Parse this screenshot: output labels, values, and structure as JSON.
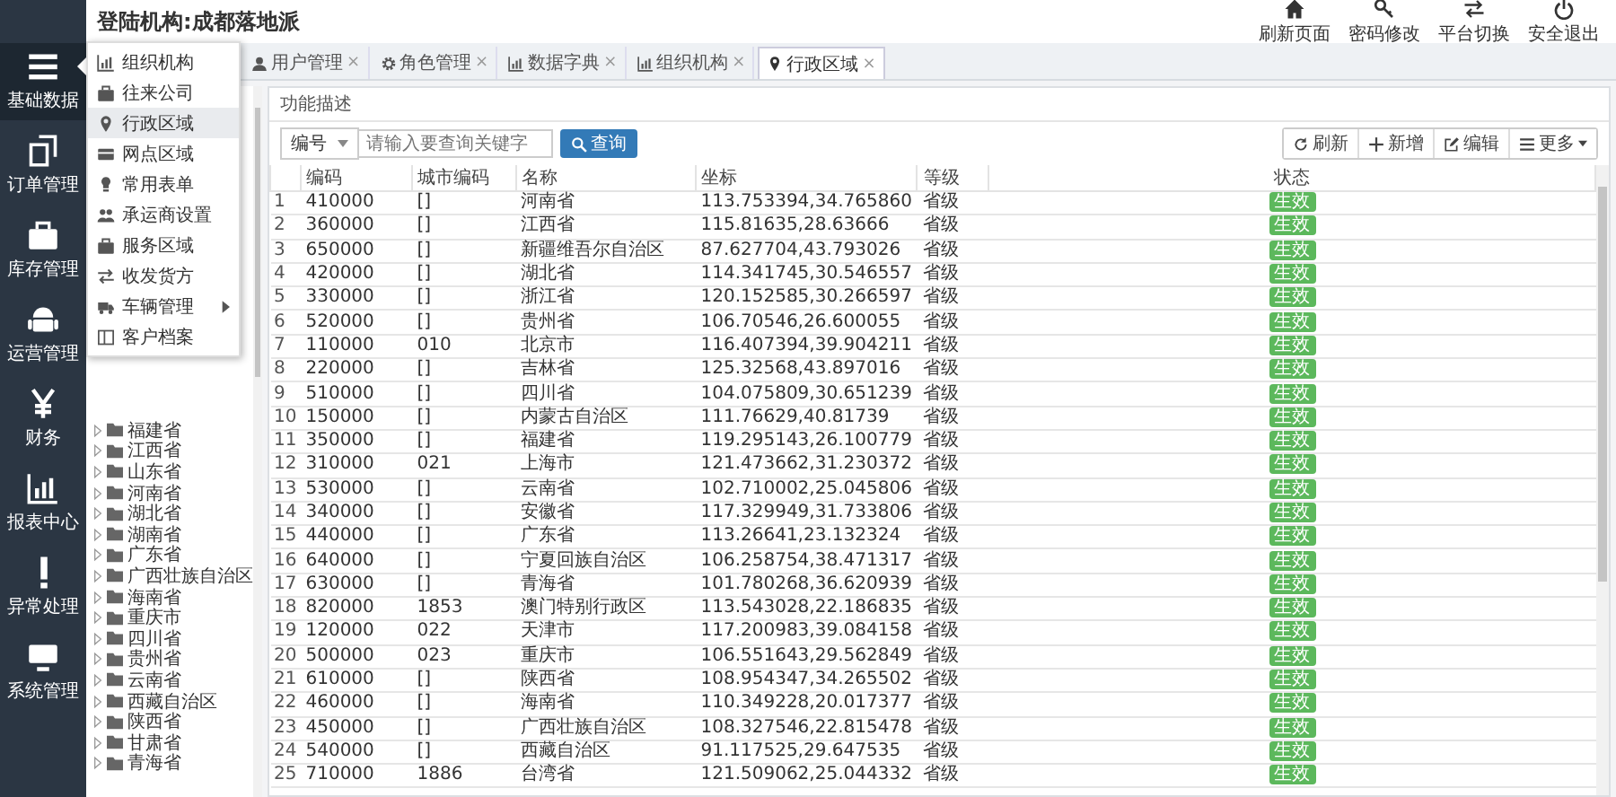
{
  "header": {
    "title": "登陆机构:成都落地派",
    "actions": [
      {
        "label": "刷新页面"
      },
      {
        "label": "密码修改"
      },
      {
        "label": "平台切换"
      },
      {
        "label": "安全退出"
      }
    ]
  },
  "nav": [
    {
      "label": "基础数据",
      "selected": true
    },
    {
      "label": "订单管理",
      "selected": false
    },
    {
      "label": "库存管理",
      "selected": false
    },
    {
      "label": "运营管理",
      "selected": false
    },
    {
      "label": "财务",
      "selected": false
    },
    {
      "label": "报表中心",
      "selected": false
    },
    {
      "label": "异常处理",
      "selected": false
    },
    {
      "label": "系统管理",
      "selected": false
    }
  ],
  "menu": [
    {
      "label": "组织机构",
      "selected": false,
      "submenu": false
    },
    {
      "label": "往来公司",
      "selected": false,
      "submenu": false
    },
    {
      "label": "行政区域",
      "selected": true,
      "submenu": false
    },
    {
      "label": "网点区域",
      "selected": false,
      "submenu": false
    },
    {
      "label": "常用表单",
      "selected": false,
      "submenu": false
    },
    {
      "label": "承运商设置",
      "selected": false,
      "submenu": false
    },
    {
      "label": "服务区域",
      "selected": false,
      "submenu": false
    },
    {
      "label": "收发货方",
      "selected": false,
      "submenu": false
    },
    {
      "label": "车辆管理",
      "selected": false,
      "submenu": true
    },
    {
      "label": "客户档案",
      "selected": false,
      "submenu": false
    }
  ],
  "tabs": [
    {
      "label": "用户管理",
      "close": "×",
      "selected": false
    },
    {
      "label": "角色管理",
      "close": "×",
      "selected": false
    },
    {
      "label": "数据字典",
      "close": "×",
      "selected": false
    },
    {
      "label": "组织机构",
      "close": "×",
      "selected": false
    },
    {
      "label": "行政区域",
      "close": "×",
      "selected": true
    }
  ],
  "tree": {
    "items": [
      {
        "label": "福建省"
      },
      {
        "label": "江西省"
      },
      {
        "label": "山东省"
      },
      {
        "label": "河南省"
      },
      {
        "label": "湖北省"
      },
      {
        "label": "湖南省"
      },
      {
        "label": "广东省"
      },
      {
        "label": "广西壮族自治区"
      },
      {
        "label": "海南省"
      },
      {
        "label": "重庆市"
      },
      {
        "label": "四川省"
      },
      {
        "label": "贵州省"
      },
      {
        "label": "云南省"
      },
      {
        "label": "西藏自治区"
      },
      {
        "label": "陕西省"
      },
      {
        "label": "甘肃省"
      },
      {
        "label": "青海省"
      }
    ]
  },
  "panel": {
    "title": "功能描述",
    "search": {
      "field": "编号",
      "placeholder": "请输入要查询关键字",
      "button": "查询"
    },
    "toolbar": [
      {
        "label": "刷新",
        "caret": false
      },
      {
        "label": "新增",
        "caret": false
      },
      {
        "label": "编辑",
        "caret": false
      },
      {
        "label": "更多",
        "caret": true
      }
    ]
  },
  "table": {
    "columns": [
      "",
      "编码",
      "城市编码",
      "名称",
      "坐标",
      "等级",
      "状态"
    ],
    "rows": [
      [
        "1",
        "410000",
        "[]",
        "河南省",
        "113.753394,34.765860",
        "省级",
        "生效"
      ],
      [
        "2",
        "360000",
        "[]",
        "江西省",
        "115.81635,28.63666",
        "省级",
        "生效"
      ],
      [
        "3",
        "650000",
        "[]",
        "新疆维吾尔自治区",
        "87.627704,43.793026",
        "省级",
        "生效"
      ],
      [
        "4",
        "420000",
        "[]",
        "湖北省",
        "114.341745,30.546557",
        "省级",
        "生效"
      ],
      [
        "5",
        "330000",
        "[]",
        "浙江省",
        "120.152585,30.266597",
        "省级",
        "生效"
      ],
      [
        "6",
        "520000",
        "[]",
        "贵州省",
        "106.70546,26.600055",
        "省级",
        "生效"
      ],
      [
        "7",
        "110000",
        "010",
        "北京市",
        "116.407394,39.904211",
        "省级",
        "生效"
      ],
      [
        "8",
        "220000",
        "[]",
        "吉林省",
        "125.32568,43.897016",
        "省级",
        "生效"
      ],
      [
        "9",
        "510000",
        "[]",
        "四川省",
        "104.075809,30.651239",
        "省级",
        "生效"
      ],
      [
        "10",
        "150000",
        "[]",
        "内蒙古自治区",
        "111.76629,40.81739",
        "省级",
        "生效"
      ],
      [
        "11",
        "350000",
        "[]",
        "福建省",
        "119.295143,26.100779",
        "省级",
        "生效"
      ],
      [
        "12",
        "310000",
        "021",
        "上海市",
        "121.473662,31.230372",
        "省级",
        "生效"
      ],
      [
        "13",
        "530000",
        "[]",
        "云南省",
        "102.710002,25.045806",
        "省级",
        "生效"
      ],
      [
        "14",
        "340000",
        "[]",
        "安徽省",
        "117.329949,31.733806",
        "省级",
        "生效"
      ],
      [
        "15",
        "440000",
        "[]",
        "广东省",
        "113.26641,23.132324",
        "省级",
        "生效"
      ],
      [
        "16",
        "640000",
        "[]",
        "宁夏回族自治区",
        "106.258754,38.471317",
        "省级",
        "生效"
      ],
      [
        "17",
        "630000",
        "[]",
        "青海省",
        "101.780268,36.620939",
        "省级",
        "生效"
      ],
      [
        "18",
        "820000",
        "1853",
        "澳门特别行政区",
        "113.543028,22.186835",
        "省级",
        "生效"
      ],
      [
        "19",
        "120000",
        "022",
        "天津市",
        "117.200983,39.084158",
        "省级",
        "生效"
      ],
      [
        "20",
        "500000",
        "023",
        "重庆市",
        "106.551643,29.562849",
        "省级",
        "生效"
      ],
      [
        "21",
        "610000",
        "[]",
        "陕西省",
        "108.954347,34.265502",
        "省级",
        "生效"
      ],
      [
        "22",
        "460000",
        "[]",
        "海南省",
        "110.349228,20.017377",
        "省级",
        "生效"
      ],
      [
        "23",
        "450000",
        "[]",
        "广西壮族自治区",
        "108.327546,22.815478",
        "省级",
        "生效"
      ],
      [
        "24",
        "540000",
        "[]",
        "西藏自治区",
        "91.117525,29.647535",
        "省级",
        "生效"
      ],
      [
        "25",
        "710000",
        "1886",
        "台湾省",
        "121.509062,25.044332",
        "省级",
        "生效"
      ]
    ]
  }
}
